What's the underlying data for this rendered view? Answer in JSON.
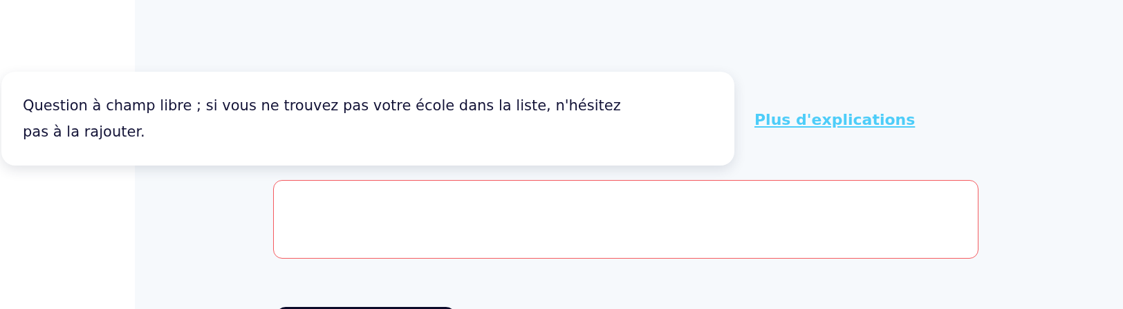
{
  "tooltip": {
    "text": "Question à champ libre ; si vous ne trouvez pas votre école dans la liste, n'hésitez pas à la rajouter."
  },
  "help_link": {
    "label": "Plus d'explications"
  },
  "answer_field": {
    "invalid": true
  }
}
